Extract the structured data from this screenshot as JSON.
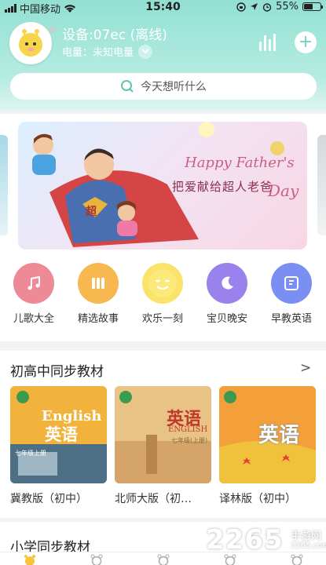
{
  "status_bar": {
    "carrier": "中国移动",
    "time": "15:40",
    "battery_percent": "55%",
    "battery_level": 0.55
  },
  "device": {
    "name": "设备:07ec (离线)",
    "battery_label": "电量：未知电量"
  },
  "search": {
    "placeholder": "今天想听什么"
  },
  "banner": {
    "script": "Happy Father's",
    "day": "Day",
    "title": "把爱献给超人老爸",
    "badge": "超"
  },
  "categories": [
    {
      "label": "儿歌大全",
      "icon": "music-note-icon",
      "color": "#ee8a95"
    },
    {
      "label": "精选故事",
      "icon": "books-icon",
      "color": "#f6b84f"
    },
    {
      "label": "欢乐一刻",
      "icon": "smiley-icon",
      "color": "#f9e36b"
    },
    {
      "label": "宝贝晚安",
      "icon": "moon-icon",
      "color": "#9a82ec"
    },
    {
      "label": "早教英语",
      "icon": "flashcard-icon",
      "color": "#7b8ef2"
    }
  ],
  "section1": {
    "title": "初高中同步教材",
    "arrow": ">",
    "books": [
      {
        "label": "冀教版（初中）",
        "cover_word": "英语",
        "cover_sub": "English",
        "grade": "七年级上册",
        "color": "#f2b33d"
      },
      {
        "label": "北师大版（初…",
        "cover_word": "英语",
        "cover_sub": "ENGLISH",
        "grade": "七年级(上册)",
        "color": "#e8c385"
      },
      {
        "label": "译林版（初中）",
        "cover_word": "英语",
        "cover_sub": "",
        "grade": "",
        "color": "#f3a03a"
      }
    ]
  },
  "section2": {
    "title": "小学同步教材"
  },
  "watermark": {
    "text": "2265",
    "sub": "手游网",
    "url": "2265.com"
  },
  "colors": {
    "accent": "#6dd3c3",
    "header_top": "#92e0d2"
  }
}
